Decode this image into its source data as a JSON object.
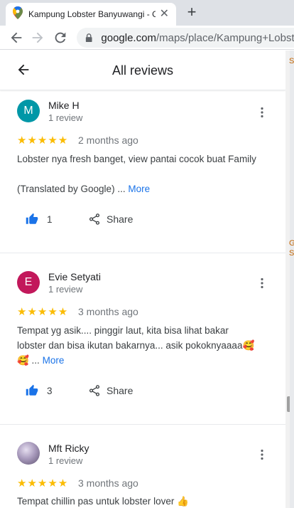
{
  "browser": {
    "tab_title": "Kampung Lobster Banyuwangi - G",
    "url_host": "google.com",
    "url_path": "/maps/place/Kampung+Lobster"
  },
  "header": {
    "title": "All reviews"
  },
  "reviews": [
    {
      "name": "Mike H",
      "avatar_letter": "M",
      "avatar_color": "#0097a7",
      "count": "1 review",
      "stars": "★★★★★",
      "when": "2 months ago",
      "text_line1": "Lobster nya fresh banget, view pantai cocok buat Family",
      "text_line2": "(Translated by Google) ...",
      "more": "More",
      "likes": "1",
      "share": "Share"
    },
    {
      "name": "Evie Setyati",
      "avatar_letter": "E",
      "avatar_color": "#c2185b",
      "count": "1 review",
      "stars": "★★★★★",
      "when": "3 months ago",
      "text_line1": "Tempat yg asik.... pinggir laut, kita bisa lihat bakar",
      "text_line2": "lobster dan bisa ikutan bakarnya... asik pokoknyaaaa🥰",
      "text_line3": "🥰 ...",
      "more": "More",
      "likes": "3",
      "share": "Share"
    },
    {
      "name": "Mft Ricky",
      "avatar_letter": "",
      "avatar_color": "#8d7b9c",
      "count": "1 review",
      "stars": "★★★★★",
      "when": "3 months ago",
      "text_line1": "Tempat chillin pas untuk lobster lover 👍"
    }
  ],
  "map_edge": {
    "label1": "S",
    "label2": "G",
    "label3": "S"
  }
}
